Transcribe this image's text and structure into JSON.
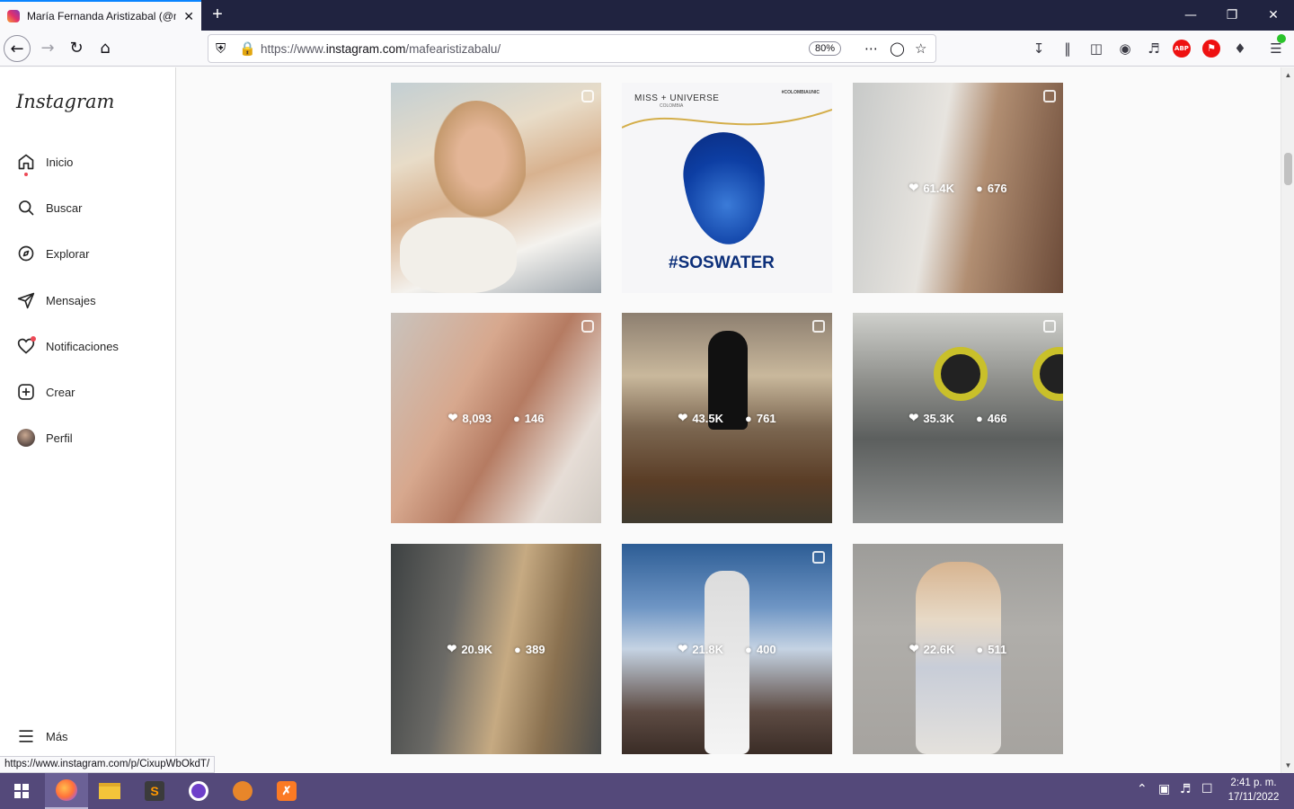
{
  "browser": {
    "tab_title": "María Fernanda Aristizabal (@m",
    "tab_close": "✕",
    "new_tab": "+",
    "url_prefix": "https://www.",
    "url_domain": "instagram.com",
    "url_path": "/mafearistizabalu/",
    "zoom": "80%",
    "status_url": "https://www.instagram.com/p/CixupWbOkdT/"
  },
  "sidebar": {
    "logo": "Instagram",
    "items": [
      {
        "label": "Inicio",
        "icon": "home-icon"
      },
      {
        "label": "Buscar",
        "icon": "search-icon"
      },
      {
        "label": "Explorar",
        "icon": "explore-icon"
      },
      {
        "label": "Mensajes",
        "icon": "messages-icon"
      },
      {
        "label": "Notificaciones",
        "icon": "heart-icon"
      },
      {
        "label": "Crear",
        "icon": "create-icon"
      },
      {
        "label": "Perfil",
        "icon": "avatar"
      }
    ],
    "more": "Más"
  },
  "posts": [
    {
      "likes": "",
      "comments": "",
      "type": "reel",
      "desc": "photo"
    },
    {
      "likes": "",
      "comments": "",
      "type": "single",
      "brand": "MISS + UNIVERSE",
      "brand_sub": "COLOMBIA",
      "tag": "#COLOMBIAUNIC",
      "hashtag": "#SOSWATER"
    },
    {
      "likes": "61.4K",
      "comments": "676",
      "type": "carousel"
    },
    {
      "likes": "8,093",
      "comments": "146",
      "type": "reel"
    },
    {
      "likes": "43.5K",
      "comments": "761",
      "type": "carousel"
    },
    {
      "likes": "35.3K",
      "comments": "466",
      "type": "carousel"
    },
    {
      "likes": "20.9K",
      "comments": "389",
      "type": "single"
    },
    {
      "likes": "21.8K",
      "comments": "400",
      "type": "carousel"
    },
    {
      "likes": "22.6K",
      "comments": "511",
      "type": "single"
    }
  ],
  "taskbar": {
    "time": "2:41 p. m.",
    "date": "17/11/2022"
  },
  "colors": {
    "titlebar": "#202340",
    "taskbar": "#54497a",
    "accent": "#0a84ff"
  }
}
